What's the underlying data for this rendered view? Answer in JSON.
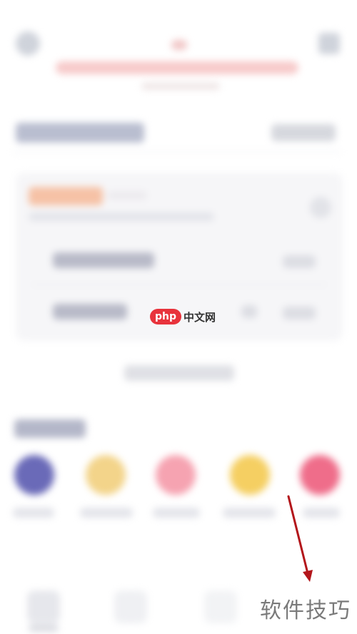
{
  "watermark": {
    "php_label": "php",
    "site_label": "中文网",
    "bottom_label": "软件技巧"
  },
  "colors": {
    "accent_red": "#e8333c",
    "arrow": "#b3161b",
    "shortcut_1": "#6a6ab8",
    "shortcut_2": "#f3d48a",
    "shortcut_3": "#f6a3b1",
    "shortcut_4": "#f5cf62",
    "shortcut_5": "#ef6d8a"
  },
  "icons": {
    "top_left": "menu-icon",
    "top_right": "scan-icon",
    "card_right": "chevron-right-icon",
    "annotation": "red-arrow-icon"
  }
}
